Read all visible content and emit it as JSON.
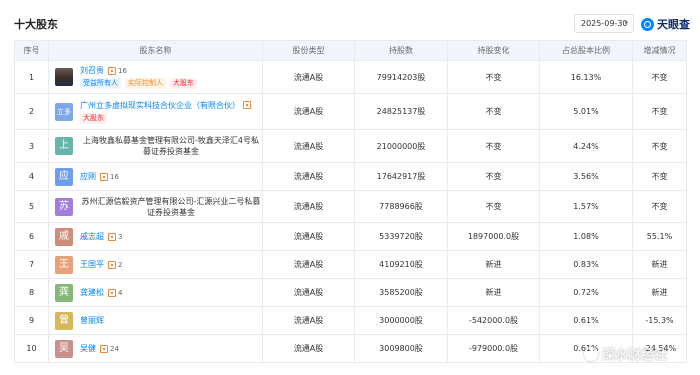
{
  "header": {
    "title": "十大股东",
    "date_value": "2025-09-30",
    "brand": "天眼查"
  },
  "columns": [
    "序号",
    "股东名称",
    "股份类型",
    "持股数",
    "持股变化",
    "占总股本比例",
    "增减情况"
  ],
  "rows": [
    {
      "no": "1",
      "avatar_text": "",
      "name": "刘召贵",
      "name_link": true,
      "rel": "16",
      "tags": [
        {
          "text": "受益所有人",
          "color": "blue"
        },
        {
          "text": "实际控制人",
          "color": "orange"
        },
        {
          "text": "大股东",
          "color": "red"
        }
      ],
      "type": "流通A股",
      "shares": "79914203股",
      "change": "不变",
      "ratio": "16.13%",
      "trend": "不变"
    },
    {
      "no": "2",
      "avatar_text": "立多",
      "name": "广州立多虚拟现实科技合伙企业（有限合伙）",
      "name_link": true,
      "rel": "",
      "tags": [
        {
          "text": "大股东",
          "color": "red"
        }
      ],
      "type": "流通A股",
      "shares": "24825137股",
      "change": "不变",
      "ratio": "5.01%",
      "trend": "不变"
    },
    {
      "no": "3",
      "avatar_text": "上",
      "name": "上海牧鑫私募基金管理有限公司-牧鑫天泽汇4号私募证券投资基金",
      "name_link": false,
      "rel": "",
      "tags": [],
      "type": "流通A股",
      "shares": "21000000股",
      "change": "不变",
      "ratio": "4.24%",
      "trend": "不变"
    },
    {
      "no": "4",
      "avatar_text": "应",
      "name": "应刚",
      "name_link": true,
      "rel": "16",
      "tags": [],
      "type": "流通A股",
      "shares": "17642917股",
      "change": "不变",
      "ratio": "3.56%",
      "trend": "不变"
    },
    {
      "no": "5",
      "avatar_text": "苏",
      "name": "苏州汇源信毅资产管理有限公司-汇源兴业二号私募证券投资基金",
      "name_link": false,
      "rel": "",
      "tags": [],
      "type": "流通A股",
      "shares": "7788966股",
      "change": "不变",
      "ratio": "1.57%",
      "trend": "不变"
    },
    {
      "no": "6",
      "avatar_text": "戚",
      "name": "戚志超",
      "name_link": true,
      "rel": "3",
      "tags": [],
      "type": "流通A股",
      "shares": "5339720股",
      "change": "1897000.0股",
      "ratio": "1.08%",
      "trend": "55.1%"
    },
    {
      "no": "7",
      "avatar_text": "王",
      "name": "王国平",
      "name_link": true,
      "rel": "2",
      "tags": [],
      "type": "流通A股",
      "shares": "4109210股",
      "change": "新进",
      "ratio": "0.83%",
      "trend": "新进"
    },
    {
      "no": "8",
      "avatar_text": "龚",
      "name": "龚建松",
      "name_link": true,
      "rel": "4",
      "tags": [],
      "type": "流通A股",
      "shares": "3585200股",
      "change": "新进",
      "ratio": "0.72%",
      "trend": "新进"
    },
    {
      "no": "9",
      "avatar_text": "曾",
      "name": "曾丽辉",
      "name_link": true,
      "rel": "",
      "tags": [],
      "type": "流通A股",
      "shares": "3000000股",
      "change": "-542000.0股",
      "ratio": "0.61%",
      "trend": "-15.3%"
    },
    {
      "no": "10",
      "avatar_text": "吴",
      "name": "吴健",
      "name_link": true,
      "rel": "24",
      "tags": [],
      "type": "流通A股",
      "shares": "3009800股",
      "change": "-979000.0股",
      "ratio": "0.61%",
      "trend": "-24.54%"
    }
  ],
  "avatar_colors": [
    "#3a2f2c",
    "#7ea7e6",
    "#67b5a8",
    "#6f9ee8",
    "#9f7fd9",
    "#cd8f7a",
    "#e8a27a",
    "#84b877",
    "#d6b85a",
    "#c9918a"
  ],
  "watermark": "深水财经社"
}
